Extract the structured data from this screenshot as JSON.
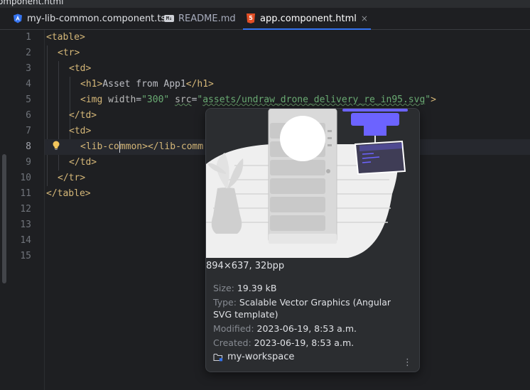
{
  "window": {
    "title_fragment": "omponent.html"
  },
  "tabs": [
    {
      "label": "my-lib-common.component.ts",
      "icon": "angular-icon",
      "active": false
    },
    {
      "label": "README.md",
      "icon": "markdown-icon",
      "active": false
    },
    {
      "label": "app.component.html",
      "icon": "html5-icon",
      "active": true
    }
  ],
  "tab_close_glyph": "×",
  "editor": {
    "line_numbers": [
      "1",
      "2",
      "3",
      "4",
      "5",
      "6",
      "7",
      "8",
      "9",
      "10",
      "11",
      "12",
      "13",
      "14",
      "15"
    ],
    "current_line": "8",
    "code": {
      "l1_open": "<table>",
      "l2_open": "<tr>",
      "l3_open": "<td>",
      "l4_h1_open": "<h1>",
      "l4_text": "Asset from App1",
      "l4_h1_close": "</h1>",
      "l5_img_open": "<img",
      "l5_attr_width": "width",
      "l5_eq1": "=",
      "l5_val_width": "\"300\"",
      "l5_attr_src": "src",
      "l5_eq2": "=",
      "l5_val_src_q1": "\"",
      "l5_val_src_text": "assets/undraw_drone_delivery_re_in95.svg",
      "l5_val_src_q2": "\"",
      "l5_gt": ">",
      "l6_close": "</td>",
      "l7_open": "<td>",
      "l8_open_a": "<lib-co",
      "l8_open_b": "mmon>",
      "l8_close_partial": "</lib-comm",
      "l9_close": "</td>",
      "l10_close": "</tr>",
      "l11_close": "</table>"
    }
  },
  "popup": {
    "dimensions": "894×637, 32bpp",
    "size_label": "Size:",
    "size_value": "19.39 kB",
    "type_label": "Type:",
    "type_value": "Scalable Vector Graphics (Angular SVG template)",
    "modified_label": "Modified:",
    "modified_value": "2023-06-19, 8:53 a.m.",
    "created_label": "Created:",
    "created_value": "2023-06-19, 8:53 a.m.",
    "folder": "my-workspace",
    "more_glyph": "⋮",
    "accent_color": "#6c63ff"
  }
}
